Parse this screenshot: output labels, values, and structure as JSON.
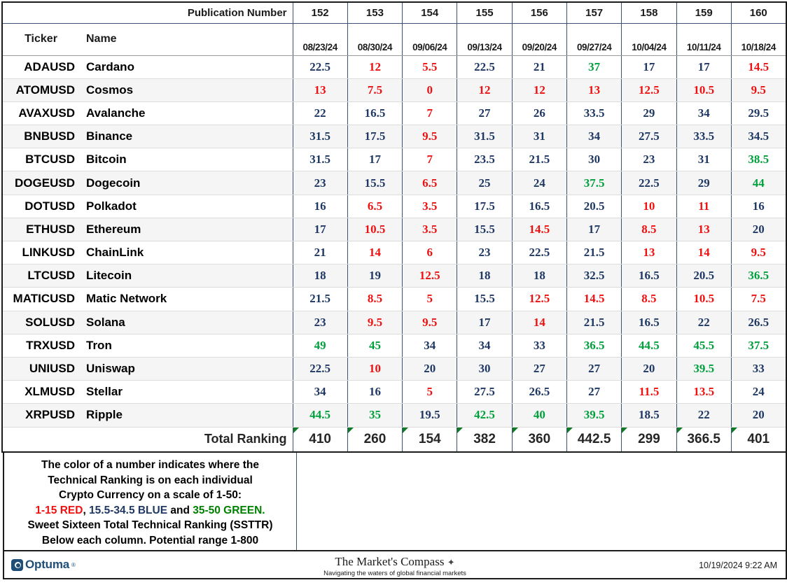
{
  "header": {
    "publication_number_label": "Publication Number",
    "ticker_label": "Ticker",
    "name_label": "Name",
    "publication_numbers": [
      "152",
      "153",
      "154",
      "155",
      "156",
      "157",
      "158",
      "159",
      "160"
    ],
    "dates": [
      "08/23/24",
      "08/30/24",
      "09/06/24",
      "09/13/24",
      "09/20/24",
      "09/27/24",
      "10/04/24",
      "10/11/24",
      "10/18/24"
    ]
  },
  "colors": {
    "red": "#ee1111",
    "blue": "#1f3864",
    "green": "#00a03c",
    "legend_green": "#008000",
    "grid_line": "#3b5476",
    "border": "#1b1b1b",
    "total_corner": "#0f7a26",
    "brand": "#1f4e79"
  },
  "rows": [
    {
      "ticker": "ADAUSD",
      "name": "Cardano",
      "values": [
        {
          "v": "22.5",
          "c": "blue"
        },
        {
          "v": "12",
          "c": "red"
        },
        {
          "v": "5.5",
          "c": "red"
        },
        {
          "v": "22.5",
          "c": "blue"
        },
        {
          "v": "21",
          "c": "blue"
        },
        {
          "v": "37",
          "c": "green"
        },
        {
          "v": "17",
          "c": "blue"
        },
        {
          "v": "17",
          "c": "blue"
        },
        {
          "v": "14.5",
          "c": "red"
        }
      ]
    },
    {
      "ticker": "ATOMUSD",
      "name": "Cosmos",
      "values": [
        {
          "v": "13",
          "c": "red"
        },
        {
          "v": "7.5",
          "c": "red"
        },
        {
          "v": "0",
          "c": "red"
        },
        {
          "v": "12",
          "c": "red"
        },
        {
          "v": "12",
          "c": "red"
        },
        {
          "v": "13",
          "c": "red"
        },
        {
          "v": "12.5",
          "c": "red"
        },
        {
          "v": "10.5",
          "c": "red"
        },
        {
          "v": "9.5",
          "c": "red"
        }
      ]
    },
    {
      "ticker": "AVAXUSD",
      "name": "Avalanche",
      "values": [
        {
          "v": "22",
          "c": "blue"
        },
        {
          "v": "16.5",
          "c": "blue"
        },
        {
          "v": "7",
          "c": "red"
        },
        {
          "v": "27",
          "c": "blue"
        },
        {
          "v": "26",
          "c": "blue"
        },
        {
          "v": "33.5",
          "c": "blue"
        },
        {
          "v": "29",
          "c": "blue"
        },
        {
          "v": "34",
          "c": "blue"
        },
        {
          "v": "29.5",
          "c": "blue"
        }
      ]
    },
    {
      "ticker": "BNBUSD",
      "name": "Binance",
      "values": [
        {
          "v": "31.5",
          "c": "blue"
        },
        {
          "v": "17.5",
          "c": "blue"
        },
        {
          "v": "9.5",
          "c": "red"
        },
        {
          "v": "31.5",
          "c": "blue"
        },
        {
          "v": "31",
          "c": "blue"
        },
        {
          "v": "34",
          "c": "blue"
        },
        {
          "v": "27.5",
          "c": "blue"
        },
        {
          "v": "33.5",
          "c": "blue"
        },
        {
          "v": "34.5",
          "c": "blue"
        }
      ]
    },
    {
      "ticker": "BTCUSD",
      "name": "Bitcoin",
      "values": [
        {
          "v": "31.5",
          "c": "blue"
        },
        {
          "v": "17",
          "c": "blue"
        },
        {
          "v": "7",
          "c": "red"
        },
        {
          "v": "23.5",
          "c": "blue"
        },
        {
          "v": "21.5",
          "c": "blue"
        },
        {
          "v": "30",
          "c": "blue"
        },
        {
          "v": "23",
          "c": "blue"
        },
        {
          "v": "31",
          "c": "blue"
        },
        {
          "v": "38.5",
          "c": "green"
        }
      ]
    },
    {
      "ticker": "DOGEUSD",
      "name": "Dogecoin",
      "values": [
        {
          "v": "23",
          "c": "blue"
        },
        {
          "v": "15.5",
          "c": "blue"
        },
        {
          "v": "6.5",
          "c": "red"
        },
        {
          "v": "25",
          "c": "blue"
        },
        {
          "v": "24",
          "c": "blue"
        },
        {
          "v": "37.5",
          "c": "green"
        },
        {
          "v": "22.5",
          "c": "blue"
        },
        {
          "v": "29",
          "c": "blue"
        },
        {
          "v": "44",
          "c": "green"
        }
      ]
    },
    {
      "ticker": "DOTUSD",
      "name": "Polkadot",
      "values": [
        {
          "v": "16",
          "c": "blue"
        },
        {
          "v": "6.5",
          "c": "red"
        },
        {
          "v": "3.5",
          "c": "red"
        },
        {
          "v": "17.5",
          "c": "blue"
        },
        {
          "v": "16.5",
          "c": "blue"
        },
        {
          "v": "20.5",
          "c": "blue"
        },
        {
          "v": "10",
          "c": "red"
        },
        {
          "v": "11",
          "c": "red"
        },
        {
          "v": "16",
          "c": "blue"
        }
      ]
    },
    {
      "ticker": "ETHUSD",
      "name": "Ethereum",
      "values": [
        {
          "v": "17",
          "c": "blue"
        },
        {
          "v": "10.5",
          "c": "red"
        },
        {
          "v": "3.5",
          "c": "red"
        },
        {
          "v": "15.5",
          "c": "blue"
        },
        {
          "v": "14.5",
          "c": "red"
        },
        {
          "v": "17",
          "c": "blue"
        },
        {
          "v": "8.5",
          "c": "red"
        },
        {
          "v": "13",
          "c": "red"
        },
        {
          "v": "20",
          "c": "blue"
        }
      ]
    },
    {
      "ticker": "LINKUSD",
      "name": "ChainLink",
      "values": [
        {
          "v": "21",
          "c": "blue"
        },
        {
          "v": "14",
          "c": "red"
        },
        {
          "v": "6",
          "c": "red"
        },
        {
          "v": "23",
          "c": "blue"
        },
        {
          "v": "22.5",
          "c": "blue"
        },
        {
          "v": "21.5",
          "c": "blue"
        },
        {
          "v": "13",
          "c": "red"
        },
        {
          "v": "14",
          "c": "red"
        },
        {
          "v": "9.5",
          "c": "red"
        }
      ]
    },
    {
      "ticker": "LTCUSD",
      "name": "Litecoin",
      "values": [
        {
          "v": "18",
          "c": "blue"
        },
        {
          "v": "19",
          "c": "blue"
        },
        {
          "v": "12.5",
          "c": "red"
        },
        {
          "v": "18",
          "c": "blue"
        },
        {
          "v": "18",
          "c": "blue"
        },
        {
          "v": "32.5",
          "c": "blue"
        },
        {
          "v": "16.5",
          "c": "blue"
        },
        {
          "v": "20.5",
          "c": "blue"
        },
        {
          "v": "36.5",
          "c": "green"
        }
      ]
    },
    {
      "ticker": "MATICUSD",
      "name": "Matic Network",
      "values": [
        {
          "v": "21.5",
          "c": "blue"
        },
        {
          "v": "8.5",
          "c": "red"
        },
        {
          "v": "5",
          "c": "red"
        },
        {
          "v": "15.5",
          "c": "blue"
        },
        {
          "v": "12.5",
          "c": "red"
        },
        {
          "v": "14.5",
          "c": "red"
        },
        {
          "v": "8.5",
          "c": "red"
        },
        {
          "v": "10.5",
          "c": "red"
        },
        {
          "v": "7.5",
          "c": "red"
        }
      ]
    },
    {
      "ticker": "SOLUSD",
      "name": "Solana",
      "values": [
        {
          "v": "23",
          "c": "blue"
        },
        {
          "v": "9.5",
          "c": "red"
        },
        {
          "v": "9.5",
          "c": "red"
        },
        {
          "v": "17",
          "c": "blue"
        },
        {
          "v": "14",
          "c": "red"
        },
        {
          "v": "21.5",
          "c": "blue"
        },
        {
          "v": "16.5",
          "c": "blue"
        },
        {
          "v": "22",
          "c": "blue"
        },
        {
          "v": "26.5",
          "c": "blue"
        }
      ]
    },
    {
      "ticker": "TRXUSD",
      "name": "Tron",
      "values": [
        {
          "v": "49",
          "c": "green"
        },
        {
          "v": "45",
          "c": "green"
        },
        {
          "v": "34",
          "c": "blue"
        },
        {
          "v": "34",
          "c": "blue"
        },
        {
          "v": "33",
          "c": "blue"
        },
        {
          "v": "36.5",
          "c": "green"
        },
        {
          "v": "44.5",
          "c": "green"
        },
        {
          "v": "45.5",
          "c": "green"
        },
        {
          "v": "37.5",
          "c": "green"
        }
      ]
    },
    {
      "ticker": "UNIUSD",
      "name": "Uniswap",
      "values": [
        {
          "v": "22.5",
          "c": "blue"
        },
        {
          "v": "10",
          "c": "red"
        },
        {
          "v": "20",
          "c": "blue"
        },
        {
          "v": "30",
          "c": "blue"
        },
        {
          "v": "27",
          "c": "blue"
        },
        {
          "v": "27",
          "c": "blue"
        },
        {
          "v": "20",
          "c": "blue"
        },
        {
          "v": "39.5",
          "c": "green"
        },
        {
          "v": "33",
          "c": "blue"
        }
      ]
    },
    {
      "ticker": "XLMUSD",
      "name": "Stellar",
      "values": [
        {
          "v": "34",
          "c": "blue"
        },
        {
          "v": "16",
          "c": "blue"
        },
        {
          "v": "5",
          "c": "red"
        },
        {
          "v": "27.5",
          "c": "blue"
        },
        {
          "v": "26.5",
          "c": "blue"
        },
        {
          "v": "27",
          "c": "blue"
        },
        {
          "v": "11.5",
          "c": "red"
        },
        {
          "v": "13.5",
          "c": "red"
        },
        {
          "v": "24",
          "c": "blue"
        }
      ]
    },
    {
      "ticker": "XRPUSD",
      "name": "Ripple",
      "values": [
        {
          "v": "44.5",
          "c": "green"
        },
        {
          "v": "35",
          "c": "green"
        },
        {
          "v": "19.5",
          "c": "blue"
        },
        {
          "v": "42.5",
          "c": "green"
        },
        {
          "v": "40",
          "c": "green"
        },
        {
          "v": "39.5",
          "c": "green"
        },
        {
          "v": "18.5",
          "c": "blue"
        },
        {
          "v": "22",
          "c": "blue"
        },
        {
          "v": "20",
          "c": "blue"
        }
      ]
    }
  ],
  "total": {
    "label": "Total Ranking",
    "values": [
      "410",
      "260",
      "154",
      "382",
      "360",
      "442.5",
      "299",
      "366.5",
      "401"
    ]
  },
  "legend": {
    "line1": "The color of a number indicates where the",
    "line2": "Technical Ranking is on each individual",
    "line3": "Crypto Currency on a scale of 1-50:",
    "line4_red": "1-15 RED",
    "line4_comma": ", ",
    "line4_blue": "15.5-34.5 BLUE",
    "line4_and": " and ",
    "line4_green": "35-50 GREEN.",
    "line5": "Sweet Sixteen Total Technical Ranking (SSTTR)",
    "line6": "Below each column.   Potential range 1-800"
  },
  "footer": {
    "optuma_name": "Optuma",
    "optuma_tm": "®",
    "compass_title": "The Market's Compass",
    "compass_star": "✦",
    "compass_tagline": "Navigating the waters of global financial markets",
    "timestamp": "10/19/2024 9:22 AM"
  }
}
